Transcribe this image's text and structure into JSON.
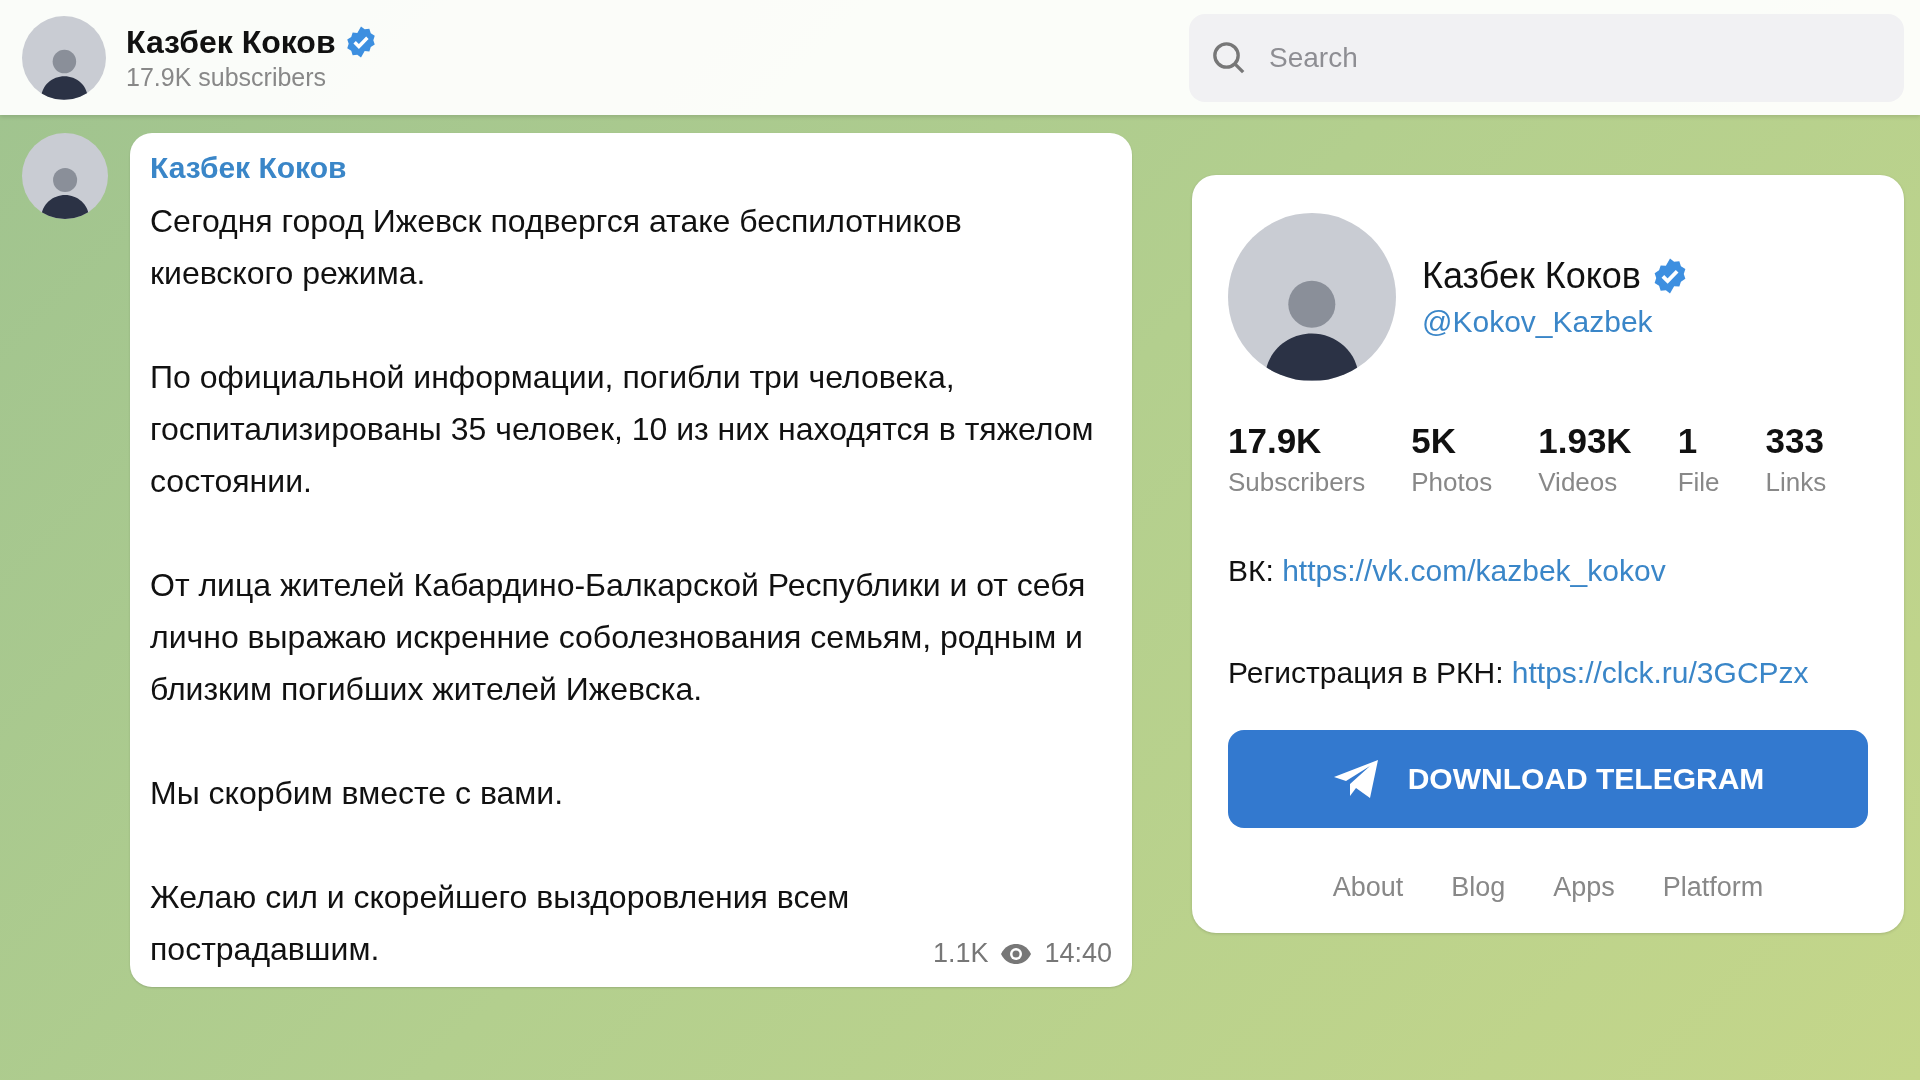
{
  "header": {
    "title": "Казбек Коков",
    "verified": true,
    "subtitle": "17.9K subscribers"
  },
  "search": {
    "placeholder": "Search"
  },
  "message": {
    "author": "Казбек Коков",
    "paragraphs": [
      "Сегодня город Ижевск подвергся атаке беспилотников киевского режима.",
      "По официальной информации, погибли три человека, госпитализированы 35 человек, 10 из них находятся в тяжелом состоянии.",
      "От лица жителей Кабардино-Балкарской Республики и от себя лично выражаю искренние соболезнования семьям, родным и близким погибших жителей Ижевска.",
      "Мы скорбим вместе с вами.",
      "Желаю сил и скорейшего выздоровления всем пострадавшим."
    ],
    "views": "1.1K",
    "time": "14:40"
  },
  "channel_card": {
    "name": "Казбек Коков",
    "verified": true,
    "username": "@Kokov_Kazbek",
    "stats": [
      {
        "value": "17.9K",
        "label": "Subscribers"
      },
      {
        "value": "5K",
        "label": "Photos"
      },
      {
        "value": "1.93K",
        "label": "Videos"
      },
      {
        "value": "1",
        "label": "File"
      },
      {
        "value": "333",
        "label": "Links"
      }
    ],
    "links": [
      {
        "label": "ВК:",
        "url": "https://vk.com/kazbek_kokov"
      },
      {
        "label": "Регистрация в РКН:",
        "url": "https://clck.ru/3GCPzx"
      }
    ],
    "download_button": "DOWNLOAD TELEGRAM",
    "footer_links": [
      "About",
      "Blog",
      "Apps",
      "Platform"
    ]
  }
}
